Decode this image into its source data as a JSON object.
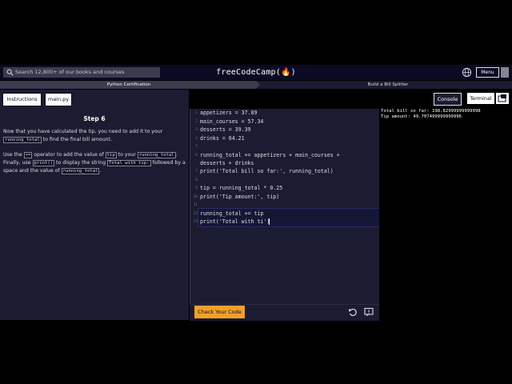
{
  "nav": {
    "search_placeholder": "Search 12,800+ of our books and courses",
    "logo": "freeCodeCamp(🔥)",
    "menu_label": "Menu"
  },
  "breadcrumb": {
    "course": "Python Certification",
    "project": "Build a Bill Splitter"
  },
  "tabs": {
    "instructions": "Instructions",
    "file": "main.py"
  },
  "instructions": {
    "step": "Step 6",
    "p1_a": "Now that you have calculated the tip, you need to add it to your ",
    "p1_code": "running_total",
    "p1_b": " to find the final bill amount.",
    "p2_a": "Use the ",
    "p2_code1": "+=",
    "p2_b": " operator to add the value of ",
    "p2_code2": "tip",
    "p2_c": " to your ",
    "p2_code3": "running_total",
    "p2_d": ". Finally, use ",
    "p2_code4": "print()",
    "p2_e": " to display the string ",
    "p2_code5": "Total with tip:",
    "p2_f": " followed by a space and the value of ",
    "p2_code6": "running_total",
    "p2_g": "."
  },
  "editor": {
    "lines": [
      {
        "n": "1",
        "text": "appetizers = 37.89"
      },
      {
        "n": "2",
        "text": "main_courses = 57.34"
      },
      {
        "n": "3",
        "text": "desserts = 39.39"
      },
      {
        "n": "4",
        "text": "drinks = 64.21"
      },
      {
        "n": "5",
        "text": ""
      },
      {
        "n": "6",
        "text": "running_total += appetizers + main_courses +"
      },
      {
        "n": "",
        "text": "desserts + drinks"
      },
      {
        "n": "7",
        "text": "print('Total bill so far:', running_total)"
      },
      {
        "n": "8",
        "text": ""
      },
      {
        "n": "9",
        "text": "tip = running_total * 0.25"
      },
      {
        "n": "10",
        "text": "print('Tip amount:', tip)"
      },
      {
        "n": "11",
        "text": ""
      },
      {
        "n": "12",
        "text": "running_total += tip"
      },
      {
        "n": "13",
        "text": "print('Total with ti')"
      }
    ]
  },
  "panel": {
    "console_label": "Console",
    "terminal_label": "Terminal"
  },
  "console_output": [
    "Total bill so far: 198.82999999999998",
    "Tip amount: 49.707499999999996"
  ],
  "footer": {
    "check_label": "Check Your Code"
  },
  "colors": {
    "accent_button": "#f1a02a",
    "nav_bg": "#0a0a23",
    "panel_bg": "#1b1b32"
  }
}
